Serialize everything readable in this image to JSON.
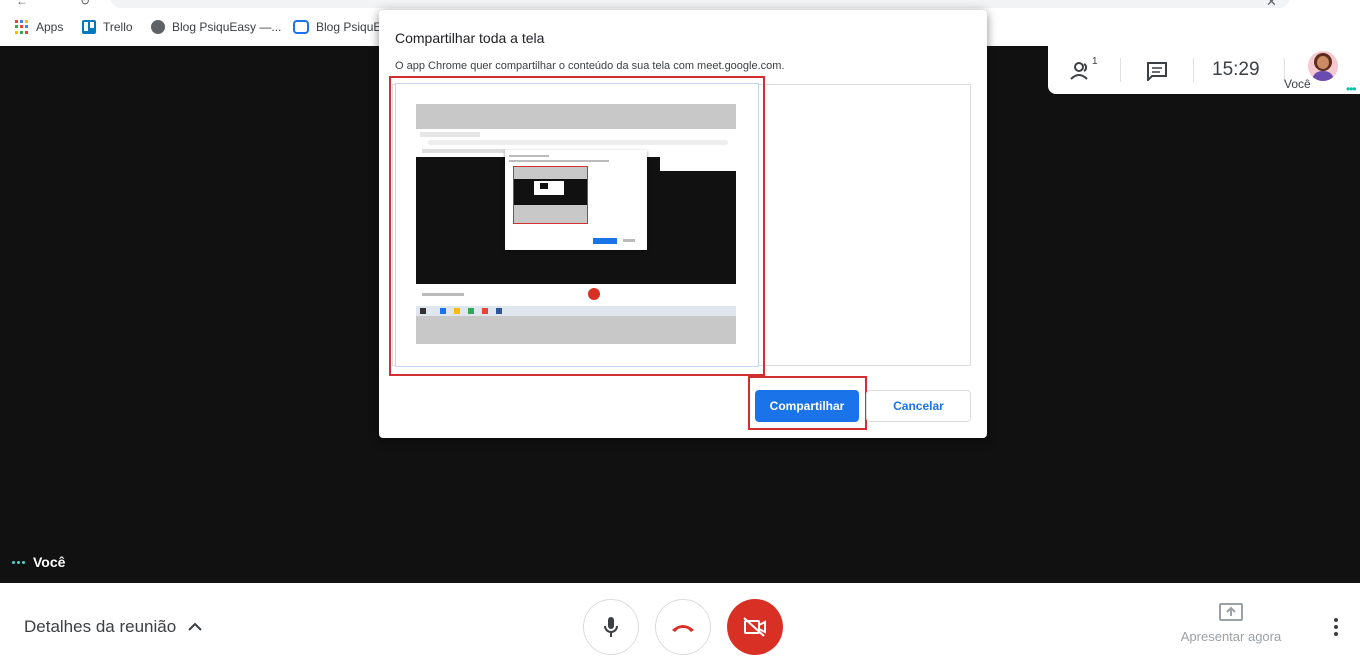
{
  "bookmarks": [
    {
      "label": "Apps",
      "icon": "apps-grid-icon"
    },
    {
      "label": "Trello",
      "icon": "trello-icon"
    },
    {
      "label": "Blog PsiquEasy —...",
      "icon": "globe-icon"
    },
    {
      "label": "Blog PsiquE",
      "icon": "cloud-icon"
    }
  ],
  "meet_panel": {
    "participants_count": "1",
    "clock": "15:29",
    "user_label": "Você"
  },
  "self_tile": {
    "label": "Você"
  },
  "bottom_bar": {
    "meeting_details": "Detalhes da reunião",
    "present_now": "Apresentar agora"
  },
  "dialog": {
    "title": "Compartilhar toda a tela",
    "description": "O app Chrome quer compartilhar o conteúdo da sua tela com meet.google.com.",
    "share_button": "Compartilhar",
    "cancel_button": "Cancelar"
  },
  "colors": {
    "accent_blue": "#1a73e8",
    "highlight_red": "#d32f2f",
    "hangup_red": "#d93025",
    "meet_background": "#111111",
    "teal_dots": "#4fd1c5"
  }
}
